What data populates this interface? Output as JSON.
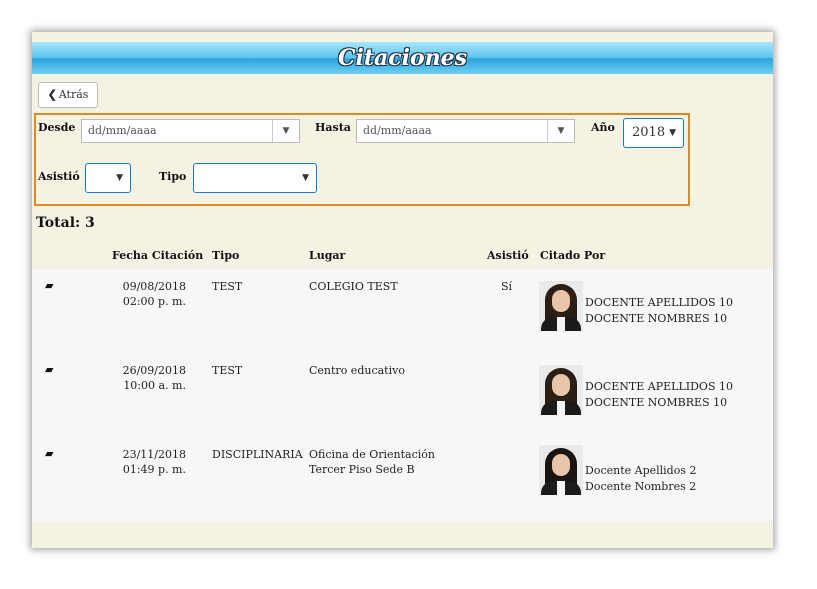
{
  "page": {
    "title": "Citaciones"
  },
  "toolbar": {
    "back_label": "Atrás"
  },
  "filters": {
    "desde_label": "Desde",
    "desde_placeholder": "dd/mm/aaaa",
    "hasta_label": "Hasta",
    "hasta_placeholder": "dd/mm/aaaa",
    "anio_label": "Año",
    "anio_value": "2018",
    "asistio_label": "Asistió",
    "asistio_value": "",
    "tipo_label": "Tipo",
    "tipo_value": ""
  },
  "total_label": "Total: 3",
  "table": {
    "headers": [
      "Fecha Citación",
      "Tipo",
      "Lugar",
      "Asistió",
      "Citado Por"
    ],
    "rows": [
      {
        "date": "09/08/2018",
        "time": "02:00 p. m.",
        "tipo": "TEST",
        "lugar": "COLEGIO TEST",
        "asistio": "Sí",
        "citado_por": "DOCENTE APELLIDOS 10 DOCENTE NOMBRES 10"
      },
      {
        "date": "26/09/2018",
        "time": "10:00 a. m.",
        "tipo": "TEST",
        "lugar": "Centro educativo",
        "asistio": "",
        "citado_por": "DOCENTE APELLIDOS 10 DOCENTE NOMBRES 10"
      },
      {
        "date": "23/11/2018",
        "time": "01:49 p. m.",
        "tipo": "DISCIPLINARIA",
        "lugar": "Oficina de Orientación Tercer Piso Sede B",
        "asistio": "",
        "citado_por": "Docente Apellidos 2 Docente Nombres 2"
      }
    ]
  },
  "icons": {
    "back": "chevron-left-icon",
    "row_action": "folder-open-icon",
    "dropdown": "caret-down-icon"
  },
  "colors": {
    "title_bar": "#29a4df",
    "filter_border": "#e08a1e",
    "select_border": "#1e77c9",
    "background": "#f4f3e3"
  }
}
